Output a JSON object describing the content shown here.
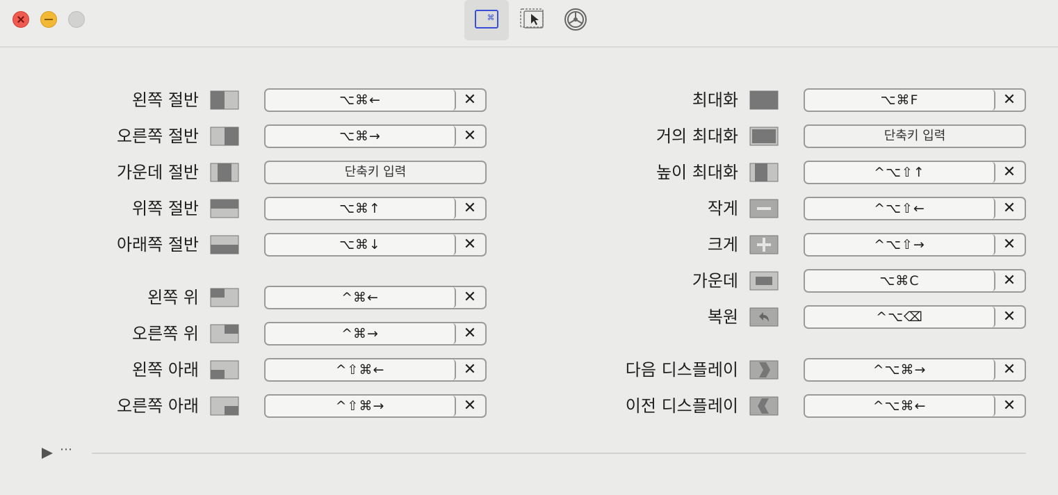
{
  "window": {
    "controls": [
      "close",
      "minimize",
      "zoom"
    ],
    "toolbar_tabs": [
      {
        "icon": "keyboard-shortcut-icon",
        "symbol": "⌘",
        "selected": true
      },
      {
        "icon": "snap-area-icon",
        "selected": false
      },
      {
        "icon": "settings-icon",
        "selected": false
      }
    ]
  },
  "left_column": [
    {
      "label": "왼쪽 절반",
      "icon": "left-half-icon",
      "shortcut": "⌥⌘←",
      "clearable": true
    },
    {
      "label": "오른쪽 절반",
      "icon": "right-half-icon",
      "shortcut": "⌥⌘→",
      "clearable": true
    },
    {
      "label": "가운데 절반",
      "icon": "center-half-icon",
      "shortcut": "",
      "placeholder": "단축키 입력",
      "clearable": false
    },
    {
      "label": "위쪽 절반",
      "icon": "top-half-icon",
      "shortcut": "⌥⌘↑",
      "clearable": true
    },
    {
      "label": "아래쪽 절반",
      "icon": "bottom-half-icon",
      "shortcut": "⌥⌘↓",
      "clearable": true
    },
    {
      "label": "왼쪽 위",
      "icon": "top-left-icon",
      "shortcut": "^⌘←",
      "clearable": true
    },
    {
      "label": "오른쪽 위",
      "icon": "top-right-icon",
      "shortcut": "^⌘→",
      "clearable": true
    },
    {
      "label": "왼쪽 아래",
      "icon": "bottom-left-icon",
      "shortcut": "^⇧⌘←",
      "clearable": true
    },
    {
      "label": "오른쪽 아래",
      "icon": "bottom-right-icon",
      "shortcut": "^⇧⌘→",
      "clearable": true
    }
  ],
  "right_column": [
    {
      "label": "최대화",
      "icon": "maximize-icon",
      "shortcut": "⌥⌘F",
      "clearable": true
    },
    {
      "label": "거의 최대화",
      "icon": "almost-maximize-icon",
      "shortcut": "",
      "placeholder": "단축키 입력",
      "clearable": false
    },
    {
      "label": "높이 최대화",
      "icon": "maximize-height-icon",
      "shortcut": "^⌥⇧↑",
      "clearable": true
    },
    {
      "label": "작게",
      "icon": "smaller-icon",
      "shortcut": "^⌥⇧←",
      "clearable": true
    },
    {
      "label": "크게",
      "icon": "larger-icon",
      "shortcut": "^⌥⇧→",
      "clearable": true
    },
    {
      "label": "가운데",
      "icon": "center-icon",
      "shortcut": "⌥⌘C",
      "clearable": true
    },
    {
      "label": "복원",
      "icon": "restore-icon",
      "shortcut": "^⌥⌫",
      "clearable": true
    },
    {
      "label": "다음 디스플레이",
      "icon": "next-display-icon",
      "shortcut": "^⌥⌘→",
      "clearable": true
    },
    {
      "label": "이전 디스플레이",
      "icon": "previous-display-icon",
      "shortcut": "^⌥⌘←",
      "clearable": true
    }
  ],
  "clear_symbol": "✕",
  "footer": {
    "expand_icon": "play-triangle-icon",
    "more_text": "⋯"
  }
}
